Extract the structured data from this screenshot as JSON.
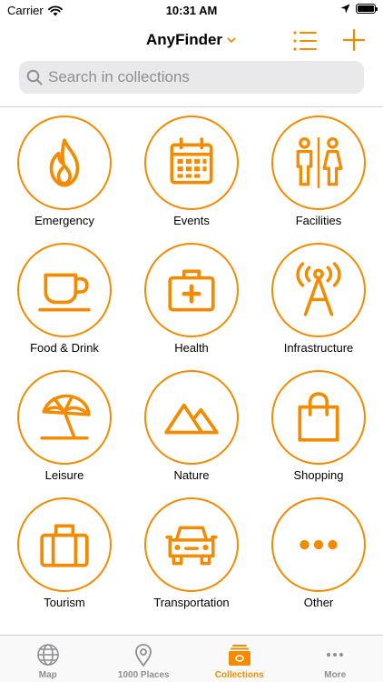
{
  "colors": {
    "accent": "#f38b00",
    "inactive": "#8e8e93",
    "search_bg": "#e9e9eb"
  },
  "status_bar": {
    "carrier": "Carrier",
    "time": "10:31 AM"
  },
  "nav": {
    "title": "AnyFinder"
  },
  "search": {
    "placeholder": "Search in collections"
  },
  "categories": [
    {
      "label": "Emergency",
      "icon": "flame-icon"
    },
    {
      "label": "Events",
      "icon": "calendar-icon"
    },
    {
      "label": "Facilities",
      "icon": "restroom-icon"
    },
    {
      "label": "Food & Drink",
      "icon": "coffee-cup-icon"
    },
    {
      "label": "Health",
      "icon": "first-aid-kit-icon"
    },
    {
      "label": "Infrastructure",
      "icon": "antenna-tower-icon"
    },
    {
      "label": "Leisure",
      "icon": "beach-umbrella-icon"
    },
    {
      "label": "Nature",
      "icon": "mountains-icon"
    },
    {
      "label": "Shopping",
      "icon": "shopping-bag-icon"
    },
    {
      "label": "Tourism",
      "icon": "suitcase-icon"
    },
    {
      "label": "Transportation",
      "icon": "car-icon"
    },
    {
      "label": "Other",
      "icon": "ellipsis-icon"
    }
  ],
  "tabs": [
    {
      "label": "Map",
      "icon": "globe-icon",
      "active": false
    },
    {
      "label": "1000 Places",
      "icon": "map-pin-icon",
      "active": false
    },
    {
      "label": "Collections",
      "icon": "collections-icon",
      "active": true
    },
    {
      "label": "More",
      "icon": "more-dots-icon",
      "active": false
    }
  ]
}
